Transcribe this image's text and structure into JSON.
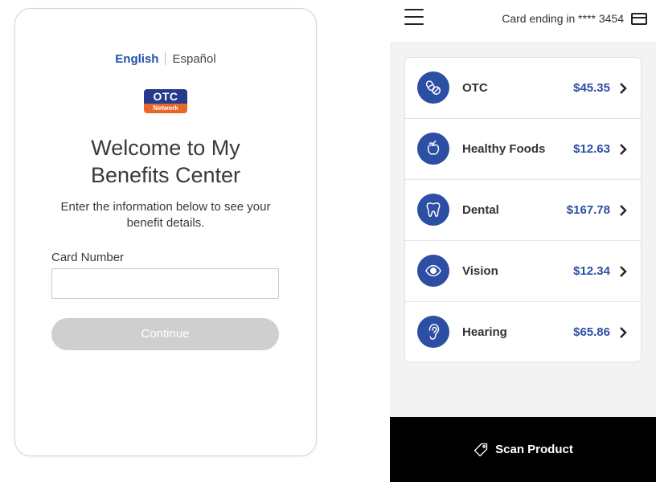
{
  "login": {
    "language_english": "English",
    "language_espanol": "Español",
    "logo_top": "OTC",
    "logo_bottom": "Network",
    "title": "Welcome to My Benefits Center",
    "subtitle": "Enter the information below to see your benefit details.",
    "card_number_label": "Card Number",
    "card_number_value": "",
    "continue_label": "Continue"
  },
  "app": {
    "card_ending_text": "Card ending in **** 3454",
    "benefits": [
      {
        "icon": "pills-icon",
        "name": "OTC",
        "amount": "$45.35"
      },
      {
        "icon": "apple-icon",
        "name": "Healthy Foods",
        "amount": "$12.63"
      },
      {
        "icon": "tooth-icon",
        "name": "Dental",
        "amount": "$167.78"
      },
      {
        "icon": "eye-icon",
        "name": "Vision",
        "amount": "$12.34"
      },
      {
        "icon": "ear-icon",
        "name": "Hearing",
        "amount": "$65.86"
      }
    ],
    "scan_label": "Scan Product"
  },
  "colors": {
    "accent_blue": "#2c4fa3",
    "logo_navy": "#253a8c",
    "logo_orange": "#e9662a",
    "disabled_button": "#cfcfcf",
    "bottom_bar": "#000000"
  }
}
